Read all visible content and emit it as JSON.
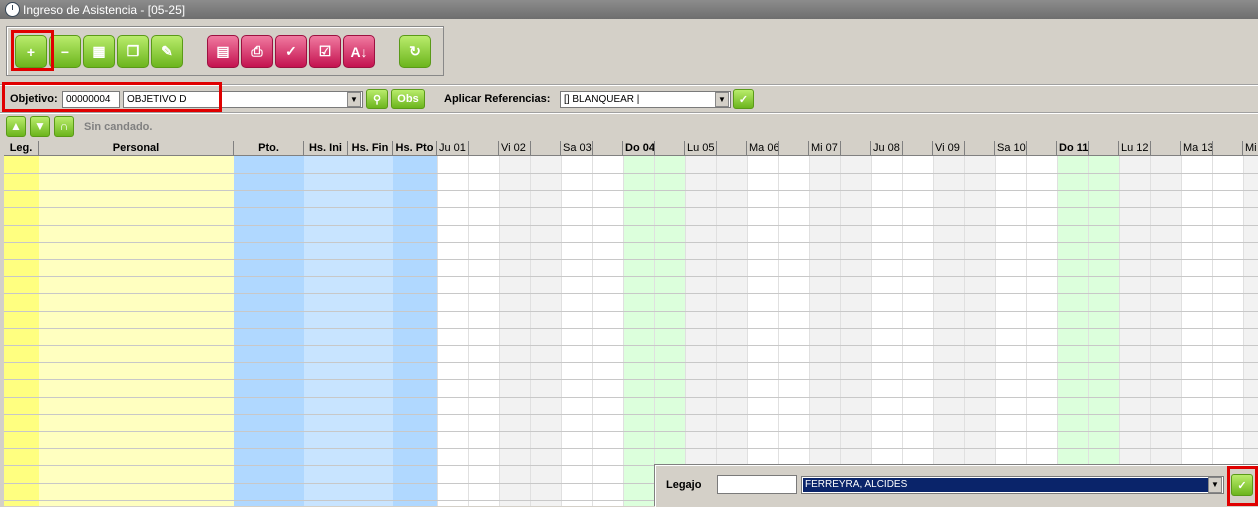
{
  "window": {
    "title": "Ingreso de Asistencia - [05-25]"
  },
  "toolbar": {
    "buttons": [
      {
        "name": "add-button",
        "icon": "plus-icon",
        "color": "green",
        "glyph": "+"
      },
      {
        "name": "remove-button",
        "icon": "minus-icon",
        "color": "green",
        "glyph": "−"
      },
      {
        "name": "calculator-button",
        "icon": "calculator-icon",
        "color": "green",
        "glyph": "▦"
      },
      {
        "name": "copy-button",
        "icon": "document-copy-icon",
        "color": "green",
        "glyph": "❐"
      },
      {
        "name": "edit-button",
        "icon": "document-edit-icon",
        "color": "green",
        "glyph": "✎"
      },
      {
        "name": "clipboard-button",
        "icon": "clipboard-icon",
        "color": "pink",
        "glyph": "▤"
      },
      {
        "name": "print-button",
        "icon": "printer-icon",
        "color": "pink",
        "glyph": "⎙"
      },
      {
        "name": "confirm-button",
        "icon": "check-icon",
        "color": "pink",
        "glyph": "✓"
      },
      {
        "name": "calendar-button",
        "icon": "calendar-check-icon",
        "color": "pink",
        "glyph": "☑"
      },
      {
        "name": "sort-button",
        "icon": "sort-az-icon",
        "color": "pink",
        "glyph": "A↓"
      },
      {
        "name": "refresh-button",
        "icon": "refresh-icon",
        "color": "green",
        "glyph": "↻"
      }
    ]
  },
  "filter": {
    "objetivo_label": "Objetivo:",
    "objetivo_code": "00000004",
    "objetivo_name": "OBJETIVO D",
    "obs_label": "Obs",
    "referencias_label": "Aplicar Referencias:",
    "referencias_value": "[] BLANQUEAR |"
  },
  "nav": {
    "status": "Sin candado."
  },
  "grid": {
    "headers": {
      "leg": "Leg.",
      "personal": "Personal",
      "pto": "Pto.",
      "hs_ini": "Hs. Ini",
      "hs_fin": "Hs. Fin",
      "hs_pto": "Hs. Pto"
    },
    "days": [
      {
        "label": "Ju 01",
        "bold": false,
        "tint": "white"
      },
      {
        "label": "Vi 02",
        "bold": false,
        "tint": "grey"
      },
      {
        "label": "Sa 03",
        "bold": false,
        "tint": "white"
      },
      {
        "label": "Do 04",
        "bold": true,
        "tint": "green"
      },
      {
        "label": "Lu 05",
        "bold": false,
        "tint": "grey"
      },
      {
        "label": "Ma 06",
        "bold": false,
        "tint": "white"
      },
      {
        "label": "Mi 07",
        "bold": false,
        "tint": "grey"
      },
      {
        "label": "Ju 08",
        "bold": false,
        "tint": "white"
      },
      {
        "label": "Vi 09",
        "bold": false,
        "tint": "grey"
      },
      {
        "label": "Sa 10",
        "bold": false,
        "tint": "white"
      },
      {
        "label": "Do 11",
        "bold": true,
        "tint": "green"
      },
      {
        "label": "Lu 12",
        "bold": false,
        "tint": "grey"
      },
      {
        "label": "Ma 13",
        "bold": false,
        "tint": "white"
      },
      {
        "label": "Mi",
        "bold": false,
        "tint": "grey"
      }
    ]
  },
  "legajo_popup": {
    "label": "Legajo",
    "value": "",
    "selected": "FERREYRA, ALCIDES"
  },
  "colors": {
    "leg": "#ffff80",
    "personal": "#ffffc0",
    "pto": "#b0d8ff",
    "hs": "#c8e4ff",
    "green": "#dcffdc",
    "grey": "#f2f2f2",
    "highlight": "#e00000",
    "selection": "#0a246a"
  }
}
